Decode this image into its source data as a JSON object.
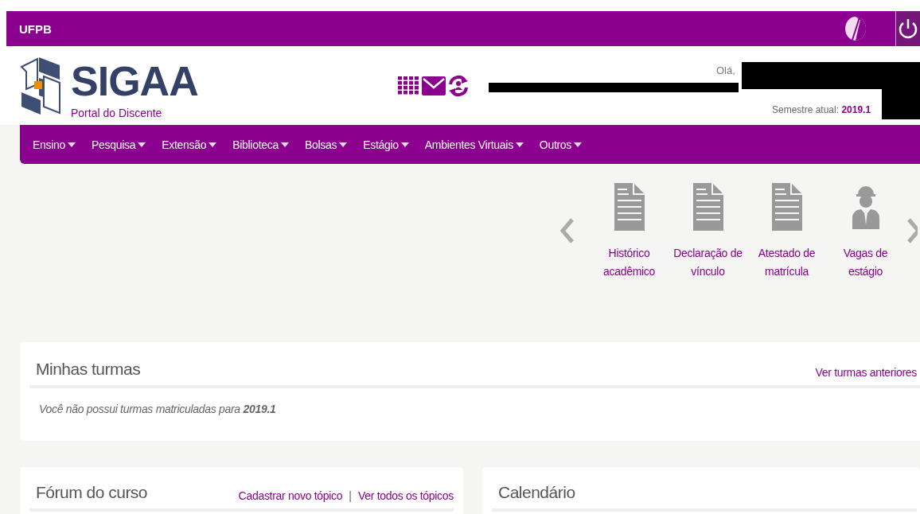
{
  "top_bar": {
    "brand": "UFPB"
  },
  "header": {
    "logo_text": "SIGAA",
    "subtitle": "Portal do Discente",
    "greeting": "Olá,",
    "semester_label": "Semestre atual:",
    "semester_value": "2019.1"
  },
  "menu": [
    {
      "label": "Ensino"
    },
    {
      "label": "Pesquisa"
    },
    {
      "label": "Extensão"
    },
    {
      "label": "Biblioteca"
    },
    {
      "label": "Bolsas"
    },
    {
      "label": "Estágio"
    },
    {
      "label": "Ambientes Virtuais"
    },
    {
      "label": "Outros"
    }
  ],
  "shortcuts": [
    {
      "label": "Histórico acadêmico",
      "kind": "document"
    },
    {
      "label": "Declaração de vínculo",
      "kind": "document"
    },
    {
      "label": "Atestado de matrícula",
      "kind": "document"
    },
    {
      "label": "Vagas de estágio",
      "kind": "worker"
    }
  ],
  "minhas_turmas": {
    "title": "Minhas turmas",
    "link": "Ver turmas anteriores",
    "message": "Você não possui turmas matriculadas para **2019.1**"
  },
  "forum": {
    "title": "Fórum do curso",
    "links": [
      "Cadastrar novo tópico",
      "Ver todos os tópicos"
    ],
    "separator": "|"
  },
  "calendar": {
    "title": "Calendário"
  }
}
